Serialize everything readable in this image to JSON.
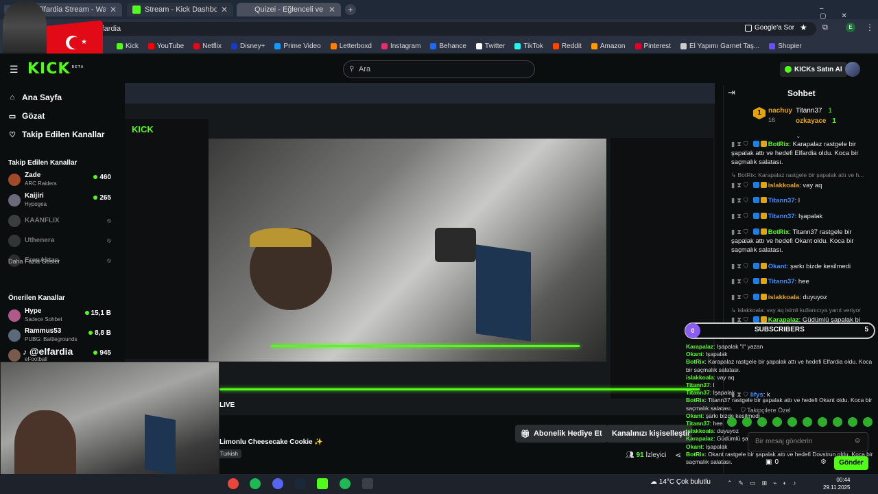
{
  "browser": {
    "tabs": [
      {
        "title": "Elfardia Stream - Watch Live on"
      },
      {
        "title": "Stream - Kick Dashboard"
      },
      {
        "title": "Quizei - Eğlenceli ve etkileşim"
      }
    ],
    "address": "elfardia",
    "google_btn": "Google'a Sor",
    "bookmarks": [
      {
        "label": "Kick",
        "color": "#53fc18"
      },
      {
        "label": "YouTube",
        "color": "#ff0000"
      },
      {
        "label": "Netflix",
        "color": "#e50914"
      },
      {
        "label": "Disney+",
        "color": "#113ccf"
      },
      {
        "label": "Prime Video",
        "color": "#1399ff"
      },
      {
        "label": "Letterboxd",
        "color": "#ff8000"
      },
      {
        "label": "Instagram",
        "color": "#e1306c"
      },
      {
        "label": "Behance",
        "color": "#1769ff"
      },
      {
        "label": "Twitter",
        "color": "#ffffff"
      },
      {
        "label": "TikTok",
        "color": "#25f4ee"
      },
      {
        "label": "Reddit",
        "color": "#ff4500"
      },
      {
        "label": "Amazon",
        "color": "#ff9900"
      },
      {
        "label": "Pinterest",
        "color": "#e60023"
      },
      {
        "label": "El Yapımı Garnet Taş...",
        "color": "#cccccc"
      },
      {
        "label": "Shopier",
        "color": "#6a4cff"
      }
    ]
  },
  "header": {
    "logo": "KICK",
    "logo_tag": "BETA",
    "search_placeholder": "Ara",
    "kicks_btn": "KICKs Satın Al"
  },
  "sidebar": {
    "nav": [
      {
        "label": "Ana Sayfa",
        "icon": "home-icon"
      },
      {
        "label": "Gözat",
        "icon": "browse-icon"
      },
      {
        "label": "Takip Edilen Kanallar",
        "icon": "heart-icon"
      }
    ],
    "followed_title": "Takip Edilen Kanallar",
    "followed": [
      {
        "name": "Zade",
        "game": "ARC Raiders",
        "viewers": "460",
        "live": true,
        "color": "#a04a2a"
      },
      {
        "name": "Kaijiri",
        "game": "Hypogea",
        "viewers": "265",
        "live": true,
        "color": "#6a6a7a"
      },
      {
        "name": "KAANFLIX",
        "game": "",
        "viewers": "",
        "live": false,
        "color": "#777"
      },
      {
        "name": "Uthenera",
        "game": "",
        "viewers": "",
        "live": false,
        "color": "#666"
      },
      {
        "name": "ErenAktan",
        "game": "",
        "viewers": "",
        "live": false,
        "color": "#555"
      }
    ],
    "show_more": "Daha Fazla Göster",
    "recommended_title": "Önerilen Kanallar",
    "recommended": [
      {
        "name": "Hype",
        "game": "Sadece Sohbet",
        "viewers": "15,1 B",
        "color": "#b05a8a"
      },
      {
        "name": "Rammus53",
        "game": "PUBG: Battlegrounds",
        "viewers": "8,8 B",
        "color": "#5a6a7a"
      },
      {
        "name": "",
        "game": "eFootball",
        "viewers": "945",
        "color": "#7a5a4a"
      }
    ]
  },
  "stream": {
    "handle": "@elfardia",
    "live": "LIVE",
    "song": "Limonlu Cheesecake Cookie ✨",
    "language": "Turkish",
    "gift_btn": "Abonelik Hediye Et",
    "customize_btn": "Kanalınızı kişiselleştir",
    "viewers_count": "91",
    "viewers_label": "İzleyici"
  },
  "chat": {
    "title": "Sohbet",
    "pinned": {
      "gifter_rank": "1",
      "gifter": "nachuy",
      "gifter_count": "16",
      "top1": "Titann37",
      "top1_count": "1",
      "top2": "ozkayace",
      "top2_count": "1"
    },
    "messages": [
      {
        "user": "BotRix",
        "color": "#53fc18",
        "text": ": Karapalaz rastgele bir şapalak attı ve hedefi Elfardia oldu. Koca bir saçmalık salatası."
      },
      {
        "reply": "↳ BotRix: Karapalaz rastgele bir şapalak attı ve h..."
      },
      {
        "user": "islakkoala",
        "color": "#e3a50b",
        "text": ": vay aq"
      },
      {
        "user": "Titann37",
        "color": "#3c8dff",
        "text": ": l"
      },
      {
        "user": "Titann37",
        "color": "#3c8dff",
        "text": ": Işapalak"
      },
      {
        "user": "BotRix",
        "color": "#53fc18",
        "text": ": Titann37 rastgele bir şapalak attı ve hedefi Okant oldu. Koca bir saçmalık salatası."
      },
      {
        "user": "Okant",
        "color": "#3c8dff",
        "text": ": şarkı bizde kesilmedi"
      },
      {
        "user": "Titann37",
        "color": "#3c8dff",
        "text": ": hee"
      },
      {
        "user": "islakkoala",
        "color": "#e3a50b",
        "text": ": duyuyoz"
      },
      {
        "reply": "↳ islakkoala: vay aq isimli kullanıcıya yanıt veriyor"
      },
      {
        "user": "Karapalaz",
        "color": "#53fc18",
        "text": ": Güdümlü şapalak bi sende mi var amk"
      }
    ],
    "subs_label": "SUBSCRIBERS",
    "subs_zero": "0",
    "subs_goal": "5",
    "overlay": [
      {
        "user": "Karapalaz",
        "text": ": Işapalak \"I\" yazan"
      },
      {
        "user": "Okant",
        "text": ": Işapalak"
      },
      {
        "user": "BotRix",
        "text": ": Karapalaz rastgele bir şapalak attı ve hedefi Elfardia oldu. Koca bir saçmalık salatası."
      },
      {
        "user": "islakkoala",
        "text": ": vay aq"
      },
      {
        "user": "Titann37",
        "text": ": l"
      },
      {
        "user": "Titann37",
        "text": ": Işapalak"
      },
      {
        "user": "BotRix",
        "text": ": Titann37 rastgele bir şapalak attı ve hedefi Okant oldu. Koca bir saçmalık salatası."
      },
      {
        "user": "Okant",
        "text": ": şarkı bizde kesilmedi"
      },
      {
        "user": "Titann37",
        "text": ": hee"
      },
      {
        "user": "islakkoala",
        "text": ": duyuyoz"
      },
      {
        "user": "Karapalaz",
        "text": ": Güdümlü şapalak bi sende mi var amk"
      },
      {
        "user": "Okant",
        "text": ": Işapalak"
      },
      {
        "user": "BotRix",
        "text": ": Okant rastgele bir şapalak attı ve hedefi Dovstrun oldu. Koca bir saçmalık salatası."
      }
    ],
    "extra_user": "lifys",
    "extra_text": ": k",
    "followers_only": "Takipçilere Özel",
    "input_placeholder": "Bir mesaj gönderin",
    "balance": "0",
    "send_btn": "Gönder"
  },
  "taskbar": {
    "weather_temp": "14°C",
    "weather_desc": "Çok bulutlu",
    "time": "00:44",
    "date": "29.11.2025"
  }
}
